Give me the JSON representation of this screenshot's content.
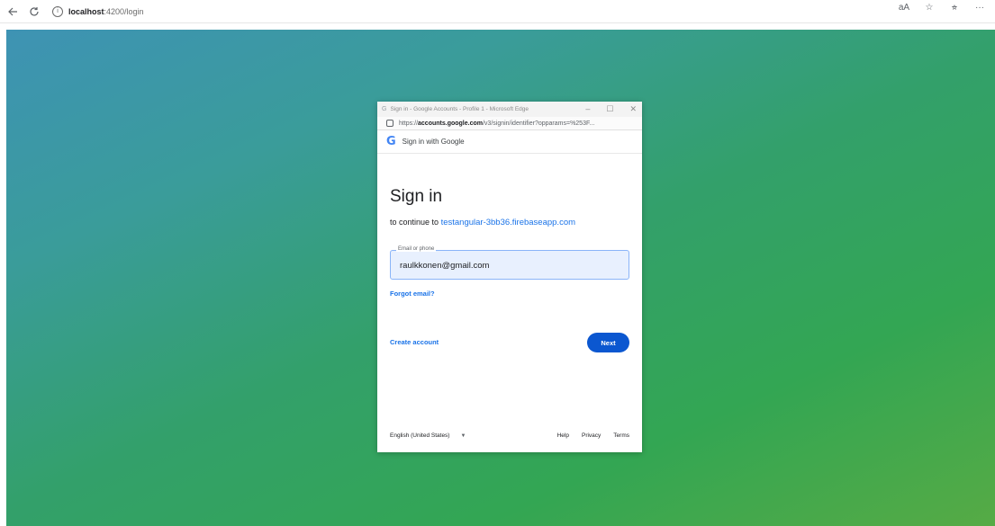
{
  "browser": {
    "url_host": "localhost",
    "url_path": ":4200/login",
    "toolbar_icons": [
      "read-aloud-icon",
      "favorite-star-icon",
      "favorites-list-icon",
      "more-icon"
    ]
  },
  "popup": {
    "window_title": "Sign in - Google Accounts - Profile 1 - Microsoft Edge",
    "url_prefix": "https://",
    "url_domain": "accounts.google.com",
    "url_rest": "/v3/signin/identifier?opparams=%253F...",
    "header_label": "Sign in with Google",
    "title": "Sign in",
    "subtitle_prefix": "to continue to",
    "app_domain": "testangular-3bb36.firebaseapp.com",
    "email_label": "Email or phone",
    "email_value": "raulkkonen@gmail.com",
    "forgot_email": "Forgot email?",
    "create_account": "Create account",
    "next": "Next",
    "language": "English (United States)",
    "help": "Help",
    "privacy": "Privacy",
    "terms": "Terms"
  }
}
